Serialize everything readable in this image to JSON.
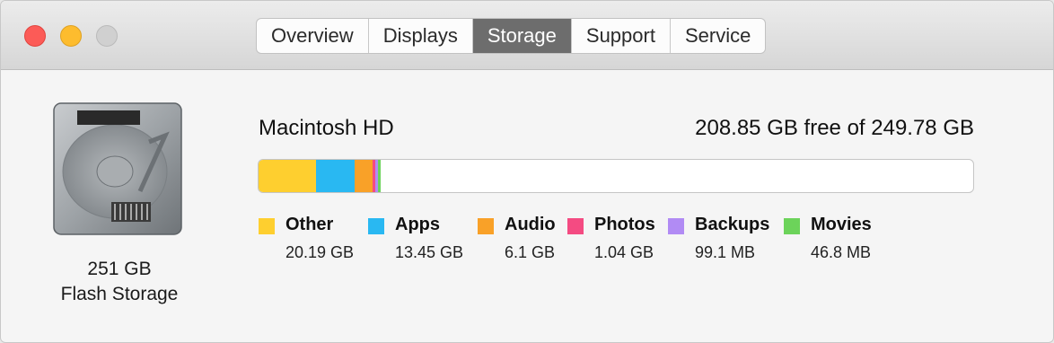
{
  "window": {
    "tabs": [
      {
        "label": "Overview"
      },
      {
        "label": "Displays"
      },
      {
        "label": "Storage",
        "active": true
      },
      {
        "label": "Support"
      },
      {
        "label": "Service"
      }
    ]
  },
  "drive": {
    "size": "251 GB",
    "type": "Flash Storage",
    "icon": "hard-drive-icon"
  },
  "volume": {
    "name": "Macintosh HD",
    "free": "208.85 GB free of 249.78 GB",
    "total_gb": 249.78,
    "free_gb": 208.85
  },
  "categories": [
    {
      "name": "Other",
      "size": "20.19 GB",
      "gb": 20.19,
      "color": "#fecf2f"
    },
    {
      "name": "Apps",
      "size": "13.45 GB",
      "gb": 13.45,
      "color": "#29b8f2"
    },
    {
      "name": "Audio",
      "size": "6.1 GB",
      "gb": 6.1,
      "color": "#f9a128"
    },
    {
      "name": "Photos",
      "size": "1.04 GB",
      "gb": 1.04,
      "color": "#f44b82"
    },
    {
      "name": "Backups",
      "size": "99.1 MB",
      "gb": 0.0991,
      "color": "#b18bf4"
    },
    {
      "name": "Movies",
      "size": "46.8 MB",
      "gb": 0.0468,
      "color": "#6cd35a"
    }
  ]
}
